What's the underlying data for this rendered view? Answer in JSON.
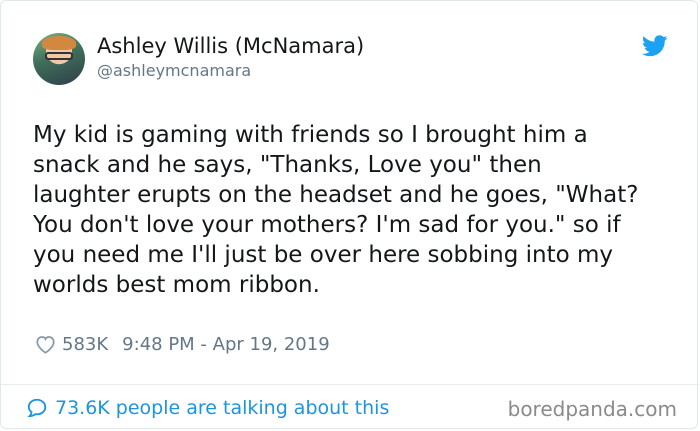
{
  "author": {
    "name": "Ashley Willis (McNamara)",
    "handle": "@ashleymcnamara",
    "avatar_icon": "profile-photo"
  },
  "tweet": {
    "lines": [
      "My kid is gaming with friends so I brought him a",
      "snack and he says, \"Thanks, Love you\" then",
      "laughter erupts on the headset and he goes, \"What?",
      "You don't love your mothers? I'm sad for you.\" so if",
      "you need me I'll just be over here sobbing into my",
      "worlds best mom ribbon."
    ],
    "likes": "583K",
    "timestamp": "9:48 PM - Apr 19, 2019"
  },
  "footer": {
    "conversation": "73.6K people are talking about this",
    "watermark": "boredpanda.com"
  },
  "icons": {
    "brand": "twitter-bird-icon",
    "like": "heart-outline-icon",
    "reply": "speech-bubble-icon"
  },
  "colors": {
    "twitter_blue": "#1da1f2",
    "link_blue": "#1b95e0",
    "text": "#14171a",
    "muted": "#657786"
  }
}
